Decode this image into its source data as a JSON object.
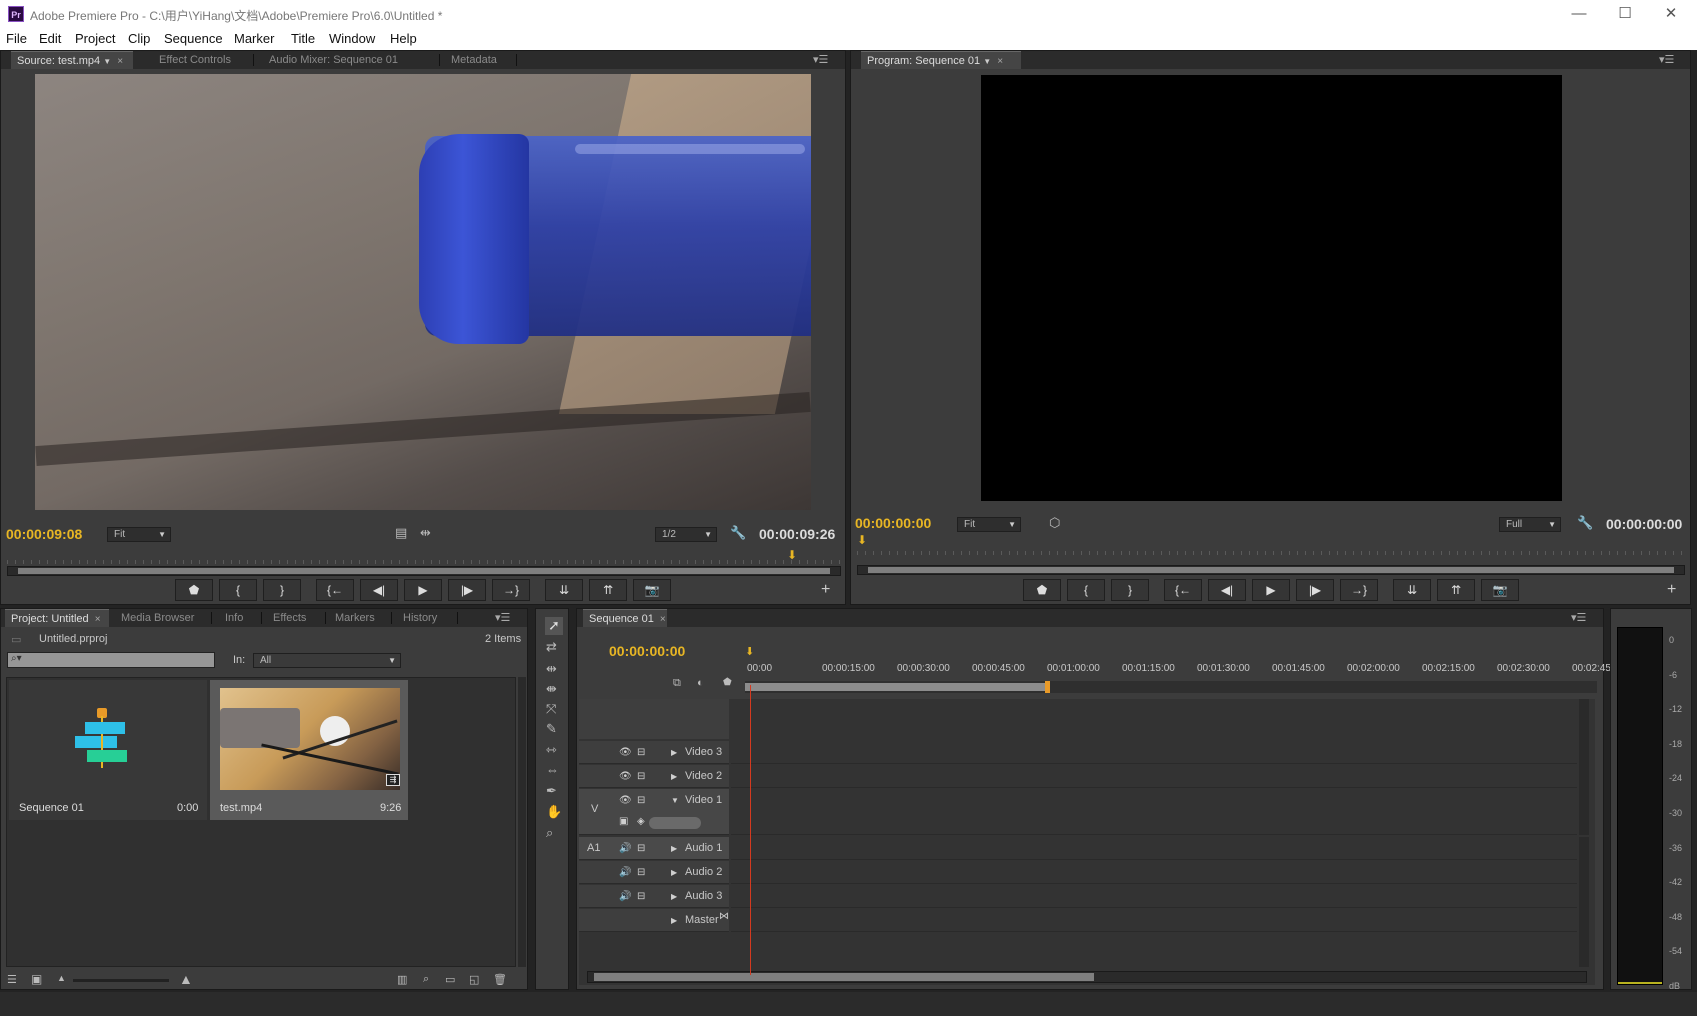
{
  "window": {
    "icon_text": "Pr",
    "title": "Adobe Premiere Pro - C:\\用户\\YiHang\\文档\\Adobe\\Premiere Pro\\6.0\\Untitled *",
    "minimize": "—",
    "maximize": "☐",
    "close": "✕"
  },
  "menu": [
    "File",
    "Edit",
    "Project",
    "Clip",
    "Sequence",
    "Marker",
    "Title",
    "Window",
    "Help"
  ],
  "source_panel": {
    "tabs": [
      "Source: test.mp4",
      "Effect Controls",
      "Audio Mixer: Sequence 01",
      "Metadata"
    ],
    "current_time": "00:00:09:08",
    "fit": "Fit",
    "resolution": "1/2",
    "duration": "00:00:09:26",
    "playhead_fraction": 0.97
  },
  "program_panel": {
    "tab": "Program: Sequence 01",
    "current_time": "00:00:00:00",
    "fit": "Fit",
    "resolution": "Full",
    "duration": "00:00:00:00"
  },
  "transport": {
    "buttons": [
      "⬟",
      "{",
      "}",
      "{←",
      "◀|",
      "▶",
      "|▶",
      "→}",
      "⇊",
      "⇈",
      "📷"
    ],
    "add": "+"
  },
  "project_panel": {
    "tabs": [
      "Project: Untitled",
      "Media Browser",
      "Info",
      "Effects",
      "Markers",
      "History"
    ],
    "project_file": "Untitled.prproj",
    "item_count": "2 Items",
    "in_label": "In:",
    "in_value": "All",
    "search_placeholder": "",
    "items": [
      {
        "name": "Sequence 01",
        "duration": "0:00"
      },
      {
        "name": "test.mp4",
        "duration": "9:26"
      }
    ]
  },
  "timeline": {
    "tab": "Sequence 01",
    "current_time": "00:00:00:00",
    "ruler": [
      "00:00",
      "00:00:15:00",
      "00:00:30:00",
      "00:00:45:00",
      "00:01:00:00",
      "00:01:15:00",
      "00:01:30:00",
      "00:01:45:00",
      "00:02:00:00",
      "00:02:15:00",
      "00:02:30:00",
      "00:02:45:"
    ],
    "video_tracks": [
      "Video 3",
      "Video 2",
      "Video 1"
    ],
    "audio_tracks": [
      "Audio 1",
      "Audio 2",
      "Audio 3"
    ],
    "master": "Master",
    "v_label": "V",
    "a_label": "A1"
  },
  "audio_meter": {
    "labels": [
      "0",
      "-6",
      "-12",
      "-18",
      "-24",
      "-30",
      "-36",
      "-42",
      "-48",
      "-54",
      "dB"
    ]
  },
  "colors": {
    "timecode": "#e8b624",
    "panel_bg": "#3c3c3c",
    "playhead": "#d43a1f"
  }
}
